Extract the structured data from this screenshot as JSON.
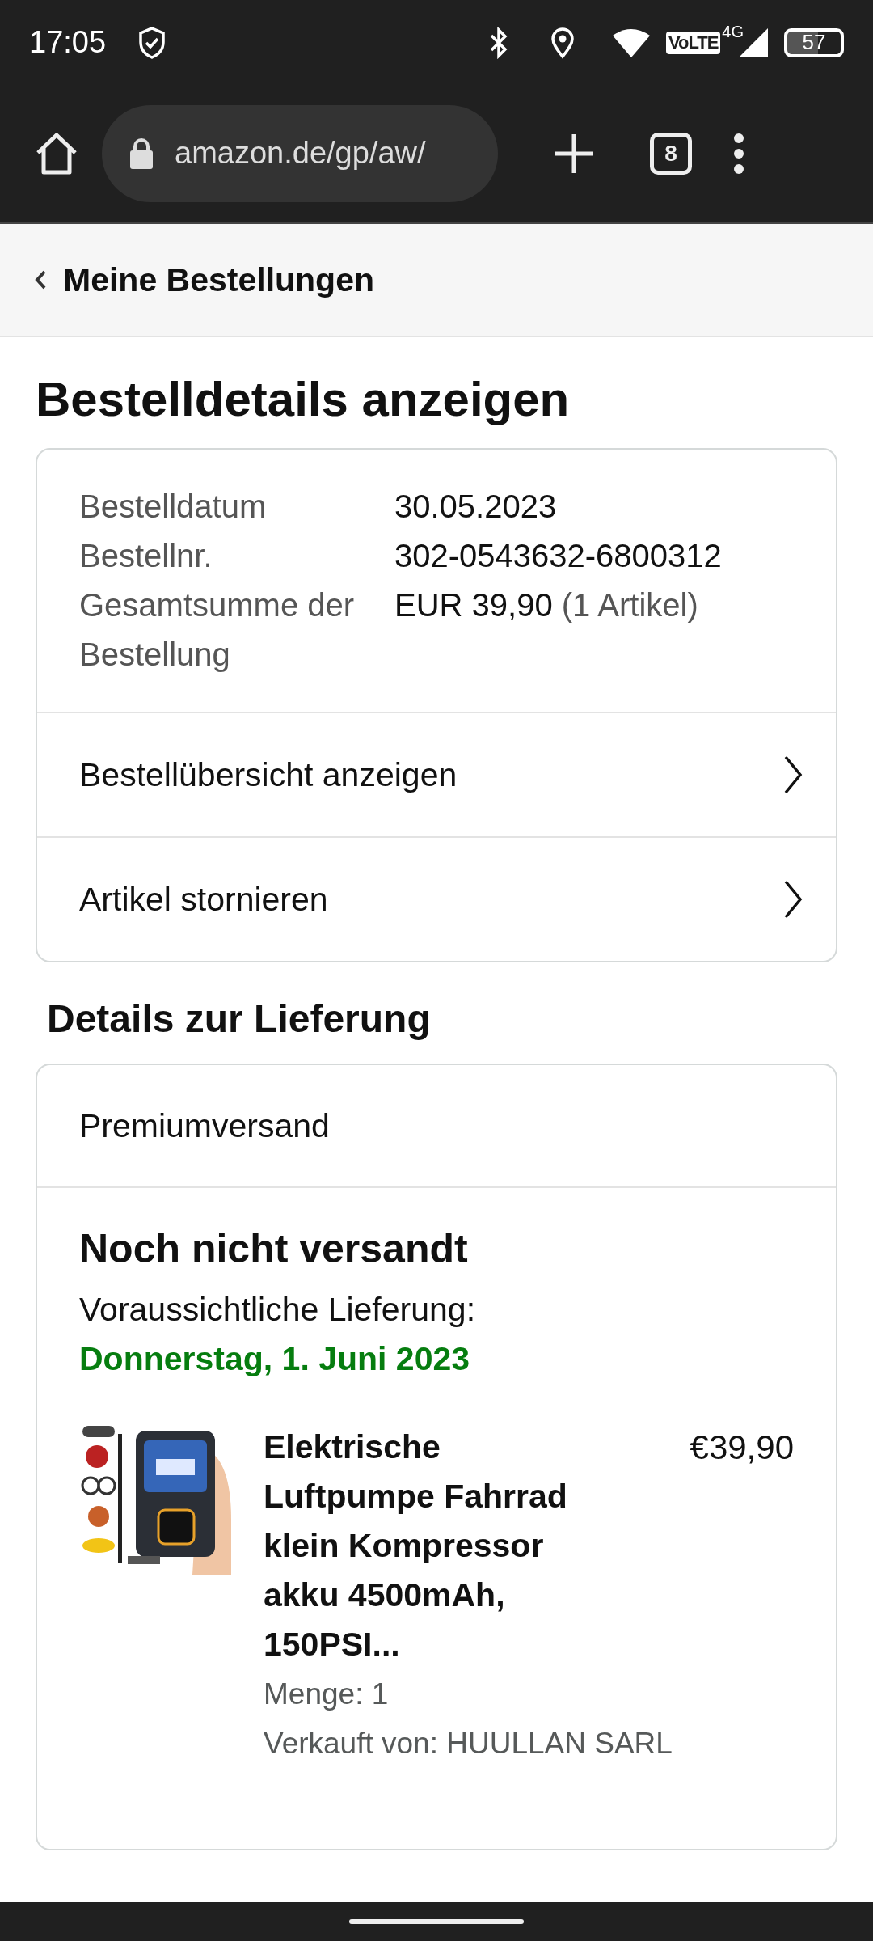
{
  "status_bar": {
    "time": "17:05",
    "volte": "VoLTE",
    "network": "4G",
    "battery": "57"
  },
  "browser": {
    "url": "amazon.de/gp/aw/",
    "tab_count": "8"
  },
  "back_link": "Meine Bestellungen",
  "title": "Bestelldetails anzeigen",
  "order_summary": [
    {
      "label": "Bestelldatum",
      "value": "30.05.2023"
    },
    {
      "label": "Bestellnr.",
      "value": "302-0543632-6800312"
    },
    {
      "label": "Gesamtsumme der Bestellung",
      "value": "EUR 39,90",
      "note": "(1 Artikel)"
    }
  ],
  "links": [
    "Bestellübersicht anzeigen",
    "Artikel stornieren"
  ],
  "delivery": {
    "heading": "Details zur Lieferung",
    "method": "Premiumversand",
    "status": "Noch nicht versandt",
    "estimate_label": "Voraussichtliche Lieferung:",
    "estimate_date": "Donnerstag, 1. Juni 2023",
    "item": {
      "kind": "picture",
      "title": "Elektrische Luftpumpe Fahrrad klein Kompressor akku 4500mAh, 150PSI...",
      "price": "€39,90",
      "quantity": "Menge: 1",
      "seller": "Verkauft von: HUULLAN SARL"
    }
  }
}
